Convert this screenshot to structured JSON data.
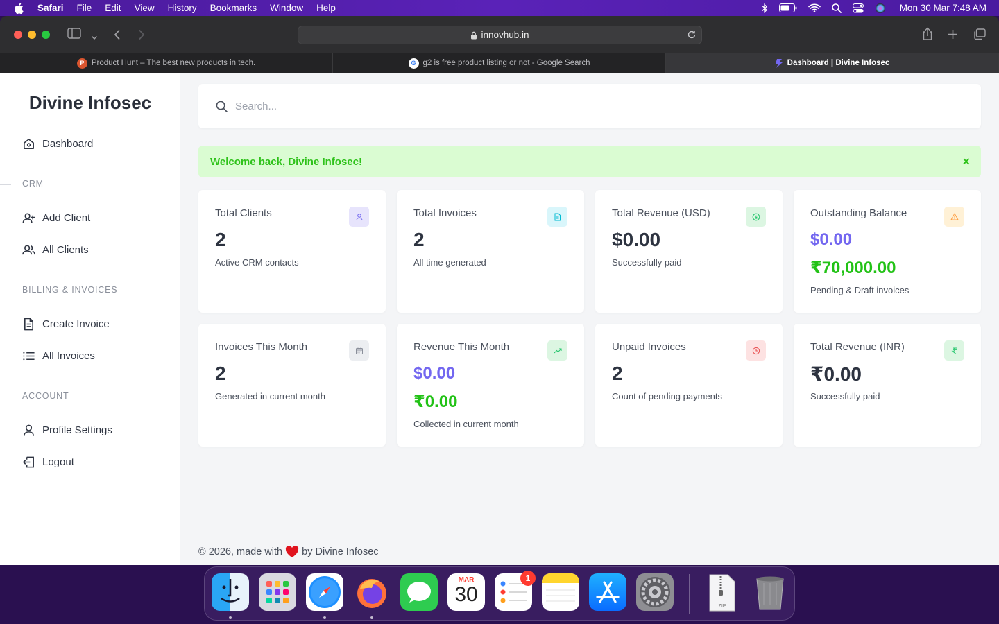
{
  "menubar": {
    "app": "Safari",
    "items": [
      "File",
      "Edit",
      "View",
      "History",
      "Bookmarks",
      "Window",
      "Help"
    ],
    "clock": "Mon 30 Mar  7:48 AM"
  },
  "browser": {
    "url": "innovhub.in",
    "tabs": [
      {
        "title": "Product Hunt – The best new products in tech.",
        "favicon": "P",
        "color": "#da552f"
      },
      {
        "title": "g2 is free product listing or not - Google Search",
        "favicon": "G",
        "color": "#4285f4"
      },
      {
        "title": "Dashboard | Divine Infosec",
        "favicon": "S",
        "color": "#7367f0"
      }
    ]
  },
  "sidebar": {
    "brand": "Divine Infosec",
    "dashboard": "Dashboard",
    "sections": {
      "crm": "CRM",
      "billing": "BILLING & INVOICES",
      "account": "ACCOUNT"
    },
    "items": {
      "add_client": "Add Client",
      "all_clients": "All Clients",
      "create_invoice": "Create Invoice",
      "all_invoices": "All Invoices",
      "profile": "Profile Settings",
      "logout": "Logout"
    }
  },
  "search": {
    "placeholder": "Search..."
  },
  "alert": {
    "message": "Welcome back, Divine Infosec!",
    "close": "×"
  },
  "cards": {
    "total_clients": {
      "title": "Total Clients",
      "value": "2",
      "sub": "Active CRM contacts"
    },
    "total_invoices": {
      "title": "Total Invoices",
      "value": "2",
      "sub": "All time generated"
    },
    "revenue_usd": {
      "title": "Total Revenue (USD)",
      "value": "$0.00",
      "sub": "Successfully paid"
    },
    "outstanding": {
      "title": "Outstanding Balance",
      "value": "$0.00",
      "value2": "₹70,000.00",
      "sub": "Pending & Draft invoices"
    },
    "invoices_month": {
      "title": "Invoices This Month",
      "value": "2",
      "sub": "Generated in current month"
    },
    "revenue_month": {
      "title": "Revenue This Month",
      "value": "$0.00",
      "value2": "₹0.00",
      "sub": "Collected in current month"
    },
    "unpaid": {
      "title": "Unpaid Invoices",
      "value": "2",
      "sub": "Count of pending payments"
    },
    "revenue_inr": {
      "title": "Total Revenue (INR)",
      "value": "₹0.00",
      "sub": "Successfully paid"
    }
  },
  "footer": {
    "prefix": "© 2026, made with",
    "suffix": "by Divine Infosec"
  },
  "dock": {
    "calendar_month": "MAR",
    "calendar_day": "30",
    "reminders_badge": "1",
    "zip_label": "ZIP"
  },
  "colors": {
    "purple": "#7367f0",
    "green": "#22c216",
    "alert_bg": "#dafcd2"
  }
}
